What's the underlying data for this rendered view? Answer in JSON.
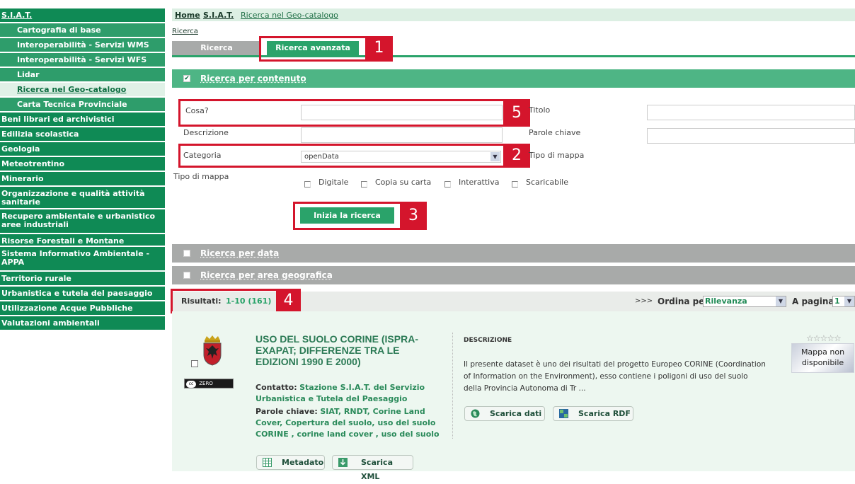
{
  "sidebar": {
    "items": [
      {
        "label": "S.I.A.T."
      },
      {
        "label": "Cartografia di base"
      },
      {
        "label": "Interoperabilità - Servizi WMS"
      },
      {
        "label": "Interoperabilità - Servizi WFS"
      },
      {
        "label": "Lidar"
      },
      {
        "label": "Ricerca nel Geo-catalogo"
      },
      {
        "label": "Carta Tecnica Provinciale"
      },
      {
        "label": "Beni librari ed archivistici"
      },
      {
        "label": "Edilizia scolastica"
      },
      {
        "label": "Geologia"
      },
      {
        "label": "Meteotrentino"
      },
      {
        "label": "Minerario"
      },
      {
        "label": "Organizzazione e qualità attività sanitarie"
      },
      {
        "label": "Recupero ambientale e urbanistico aree industriali"
      },
      {
        "label": "Risorse Forestali e Montane"
      },
      {
        "label": "Sistema Informativo Ambientale - APPA"
      },
      {
        "label": "Territorio rurale"
      },
      {
        "label": "Urbanistica e tutela del paesaggio"
      },
      {
        "label": "Utilizzazione Acque Pubbliche"
      },
      {
        "label": "Valutazioni ambientali"
      }
    ]
  },
  "breadcrumb": {
    "home": "Home",
    "siat": "S.I.A.T.",
    "current": "Ricerca nel Geo-catalogo"
  },
  "small_link": "Ricerca",
  "tabs": {
    "basic": "Ricerca",
    "advanced": "Ricerca avanzata"
  },
  "callouts": {
    "n1": "1",
    "n2": "2",
    "n3": "3",
    "n4": "4",
    "n5": "5"
  },
  "content_search": {
    "title": "Ricerca per contenuto",
    "cosa_label": "Cosa?",
    "descrizione_label": "Descrizione",
    "categoria_label": "Categoria",
    "categoria_value": "openData",
    "tipo_label": "Tipo di mappa",
    "titolo_label": "Titolo",
    "parole_label": "Parole chiave",
    "tipo_right_label": "Tipo di mappa",
    "checkboxes": [
      "Digitale",
      "Copia su carta",
      "Interattiva",
      "Scaricabile"
    ],
    "search_button": "Inizia la ricerca"
  },
  "date_search": {
    "title": "Ricerca per data"
  },
  "geo_search": {
    "title": "Ricerca per area geografica"
  },
  "results": {
    "label": "Risultati:",
    "range": "1-10 (161)",
    "arrows": ">>>",
    "order_label": "Ordina per",
    "order_value": "Rilevanza",
    "page_label": "A pagina",
    "page_value": "1"
  },
  "result_card": {
    "title": "USO DEL SUOLO CORINE (ISPRA-EXAPAT; DIFFERENZE TRA LE EDIZIONI 1990 E 2000)",
    "contact_label": "Contatto:",
    "contact_value": "Stazione S.I.A.T. del Servizio Urbanistica e Tutela del Paesaggio",
    "keywords_label": "Parole chiave:",
    "keywords_value": "SIAT, RNDT, Corine Land Cover, Copertura del suolo, uso del suolo CORINE , corine land cover , uso del suolo",
    "license": "ZERO",
    "metadata_btn": "Metadato",
    "xml_btn": "Scarica XML",
    "desc_heading": "DESCRIZIONE",
    "desc_text": "Il presente dataset è uno dei risultati del progetto Europeo CORINE (Coordination of Information on the Environment), esso contiene i poligoni di uso del suolo della Provincia Autonoma di Tr ...",
    "download_btn": "Scarica dati",
    "rdf_btn": "Scarica RDF",
    "stars": "☆☆☆☆☆",
    "map_placeholder": "Mappa non disponibile"
  },
  "colors": {
    "green": "#2aa36a",
    "sidebar": "#0f8a55",
    "callout": "#d4152c"
  }
}
